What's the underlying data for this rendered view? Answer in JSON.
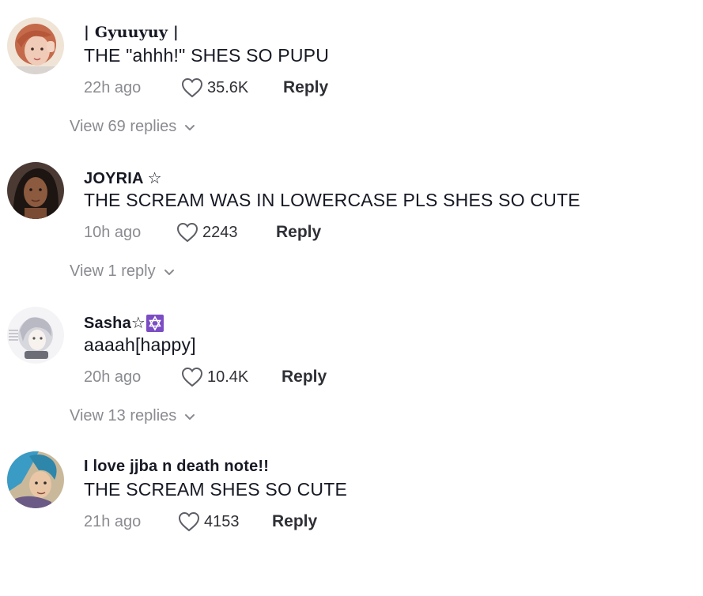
{
  "comments": [
    {
      "username": "| Gyuuyuy |",
      "text": "THE \"ahhh!\" SHES SO PUPU",
      "time": "22h ago",
      "likes": "35.6K",
      "reply_label": "Reply",
      "view_replies": "View 69 replies",
      "avatar_color": "#d9a48f"
    },
    {
      "username": "JOYRIA ☆",
      "text": "THE SCREAM WAS IN LOWERCASE PLS SHES SO CUTE",
      "time": "10h ago",
      "likes": "2243",
      "reply_label": "Reply",
      "view_replies": "View 1 reply",
      "avatar_color": "#3b2a24"
    },
    {
      "username": "Sasha☆",
      "text": "aaaah[happy]",
      "time": "20h ago",
      "likes": "10.4K",
      "reply_label": "Reply",
      "view_replies": "View 13 replies",
      "avatar_color": "#e6e6ea",
      "badge_icon": "star-of-david-icon"
    },
    {
      "username": "I love jjba n death note!!",
      "text": "THE SCREAM SHES SO CUTE",
      "time": "21h ago",
      "likes": "4153",
      "reply_label": "Reply",
      "avatar_color": "#3a9bc4"
    }
  ],
  "colors": {
    "text_primary": "#161823",
    "text_secondary": "#8a8b91",
    "badge_purple": "#7b4cc4"
  }
}
